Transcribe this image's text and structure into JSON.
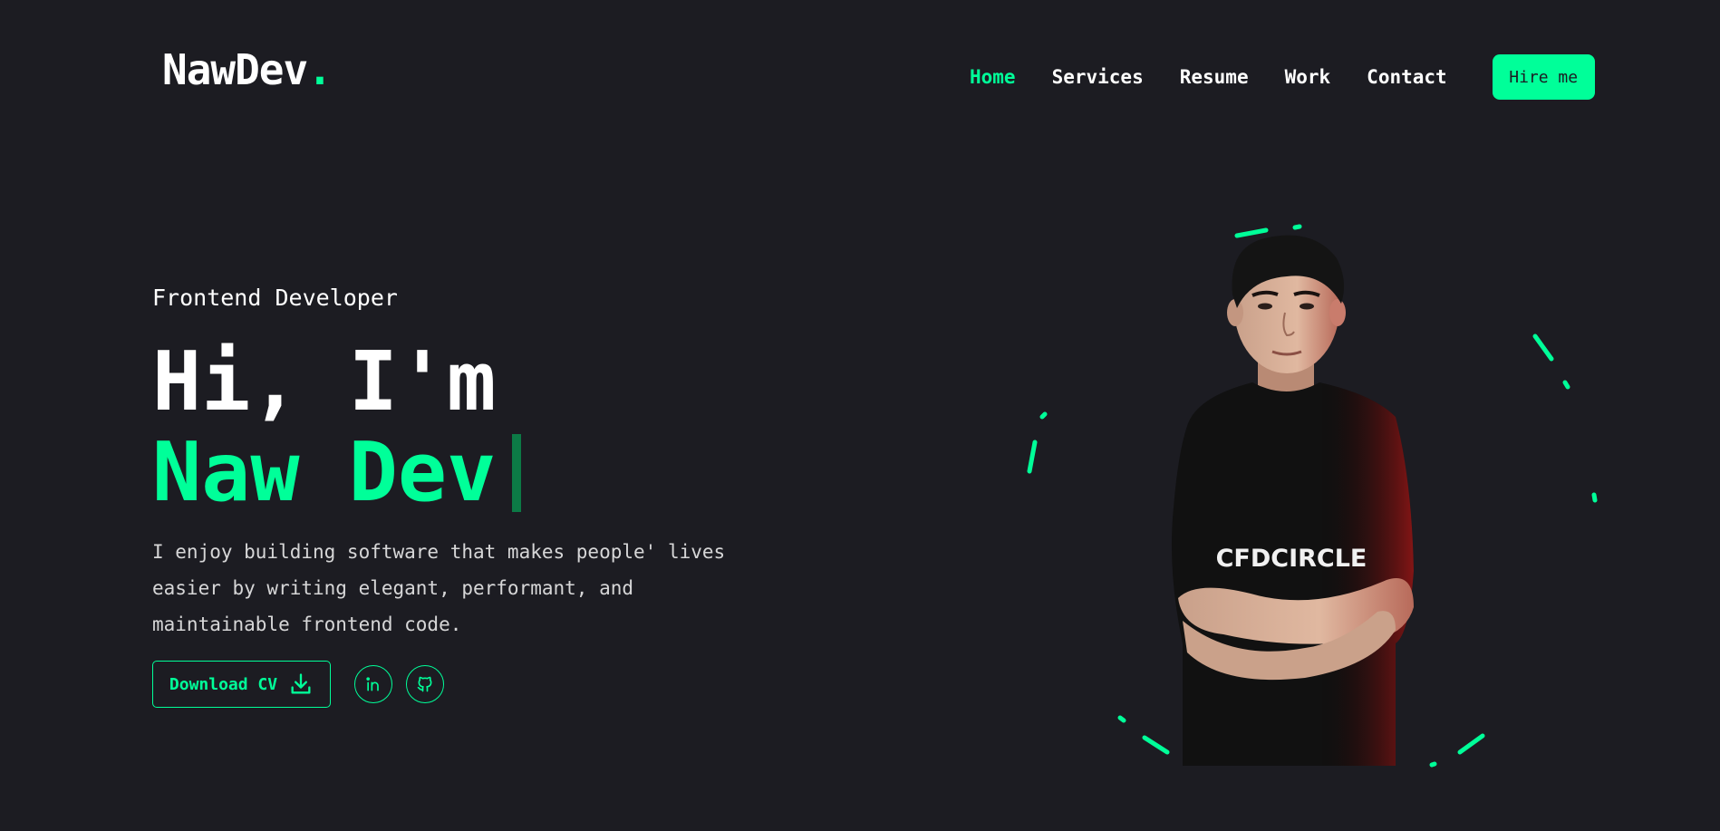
{
  "header": {
    "logo_text": "NawDev",
    "logo_dot": ".",
    "nav": [
      {
        "label": "Home",
        "active": true
      },
      {
        "label": "Services",
        "active": false
      },
      {
        "label": "Resume",
        "active": false
      },
      {
        "label": "Work",
        "active": false
      },
      {
        "label": "Contact",
        "active": false
      }
    ],
    "hire_label": "Hire me"
  },
  "hero": {
    "role": "Frontend Developer",
    "greeting": "Hi, I'm",
    "name": "Naw Dev",
    "intro": "I enjoy building software that makes people' lives easier by writing elegant, performant, and maintainable frontend code.",
    "cv_label": "Download CV",
    "socials": [
      {
        "name": "linkedin-icon"
      },
      {
        "name": "github-icon"
      }
    ],
    "shirt_text": "CFDCIRCLE"
  },
  "colors": {
    "background": "#1c1c22",
    "accent": "#00ff99",
    "text": "#ffffff"
  }
}
